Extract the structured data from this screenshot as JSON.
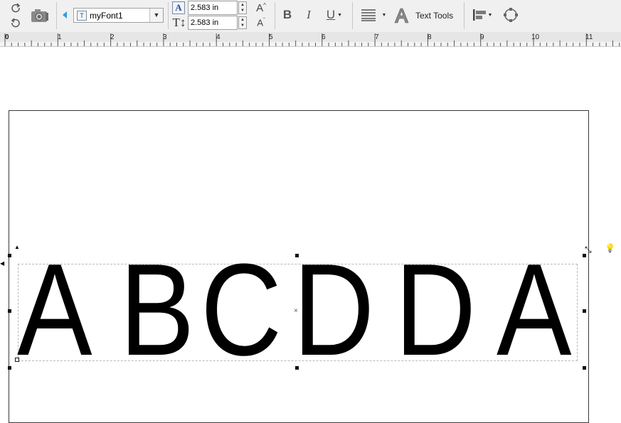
{
  "toolbar": {
    "rotate_cw_icon": "rotate-clockwise-icon",
    "rotate_ccw_icon": "rotate-counterclockwise-icon",
    "camera_icon": "camera-icon",
    "font": {
      "name": "myFont1",
      "expand_icon": "triangle-left-icon"
    },
    "width_value": "2.583 in",
    "height_value": "2.583 in",
    "font_grow_icon": "font-increase-icon",
    "font_shrink_icon": "font-decrease-icon",
    "bold_label": "B",
    "italic_label": "I",
    "underline_label": "U",
    "align_icon": "align-lines-icon",
    "text_tools_label": "Text Tools",
    "arrange_icon": "arrange-icon",
    "shape_icon": "shape-circle-icon"
  },
  "ruler": {
    "labels": [
      "0",
      "1",
      "2",
      "3",
      "4",
      "5",
      "6",
      "7",
      "8",
      "9",
      "10",
      "11"
    ]
  },
  "canvas": {
    "text": [
      "A",
      "B",
      "C",
      "D",
      "D",
      "A"
    ],
    "colors": {
      "text": "#000000",
      "page_border": "#3a3a3a",
      "handle": "#111111"
    }
  }
}
